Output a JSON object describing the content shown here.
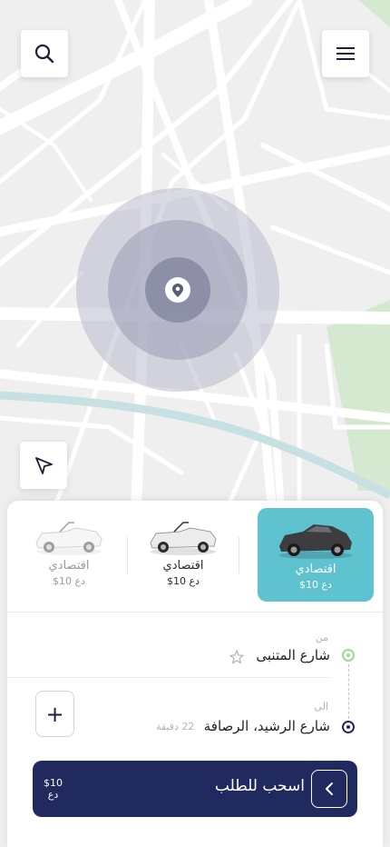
{
  "header": {
    "search_icon": "search-icon",
    "menu_icon": "hamburger-menu-icon"
  },
  "map": {
    "locate_icon": "navigation-arrow-icon",
    "marker_icon": "location-pin-icon"
  },
  "vehicles": [
    {
      "name": "اقتصادي",
      "price": "$10 دع",
      "selected": true
    },
    {
      "name": "اقتصادي",
      "price": "$10 دع",
      "selected": false
    },
    {
      "name": "اقتصادي",
      "price": "$10 دع",
      "selected": false
    }
  ],
  "route": {
    "from_label": "من",
    "from_value": "شارع المتنبى",
    "to_label": "الى",
    "to_value": "شارع الرشيد، الرصافة",
    "eta": "22 دقيقة"
  },
  "order": {
    "label": "اسحب للطلب",
    "price_amount": "$10",
    "price_currency": "دع"
  },
  "colors": {
    "accent": "#5ec3cf",
    "primary_dark": "#202a5e",
    "start_pin": "#9ed59a",
    "end_pin": "#202a5e",
    "park": "#d4e9cf",
    "river": "#c7e1e3"
  }
}
